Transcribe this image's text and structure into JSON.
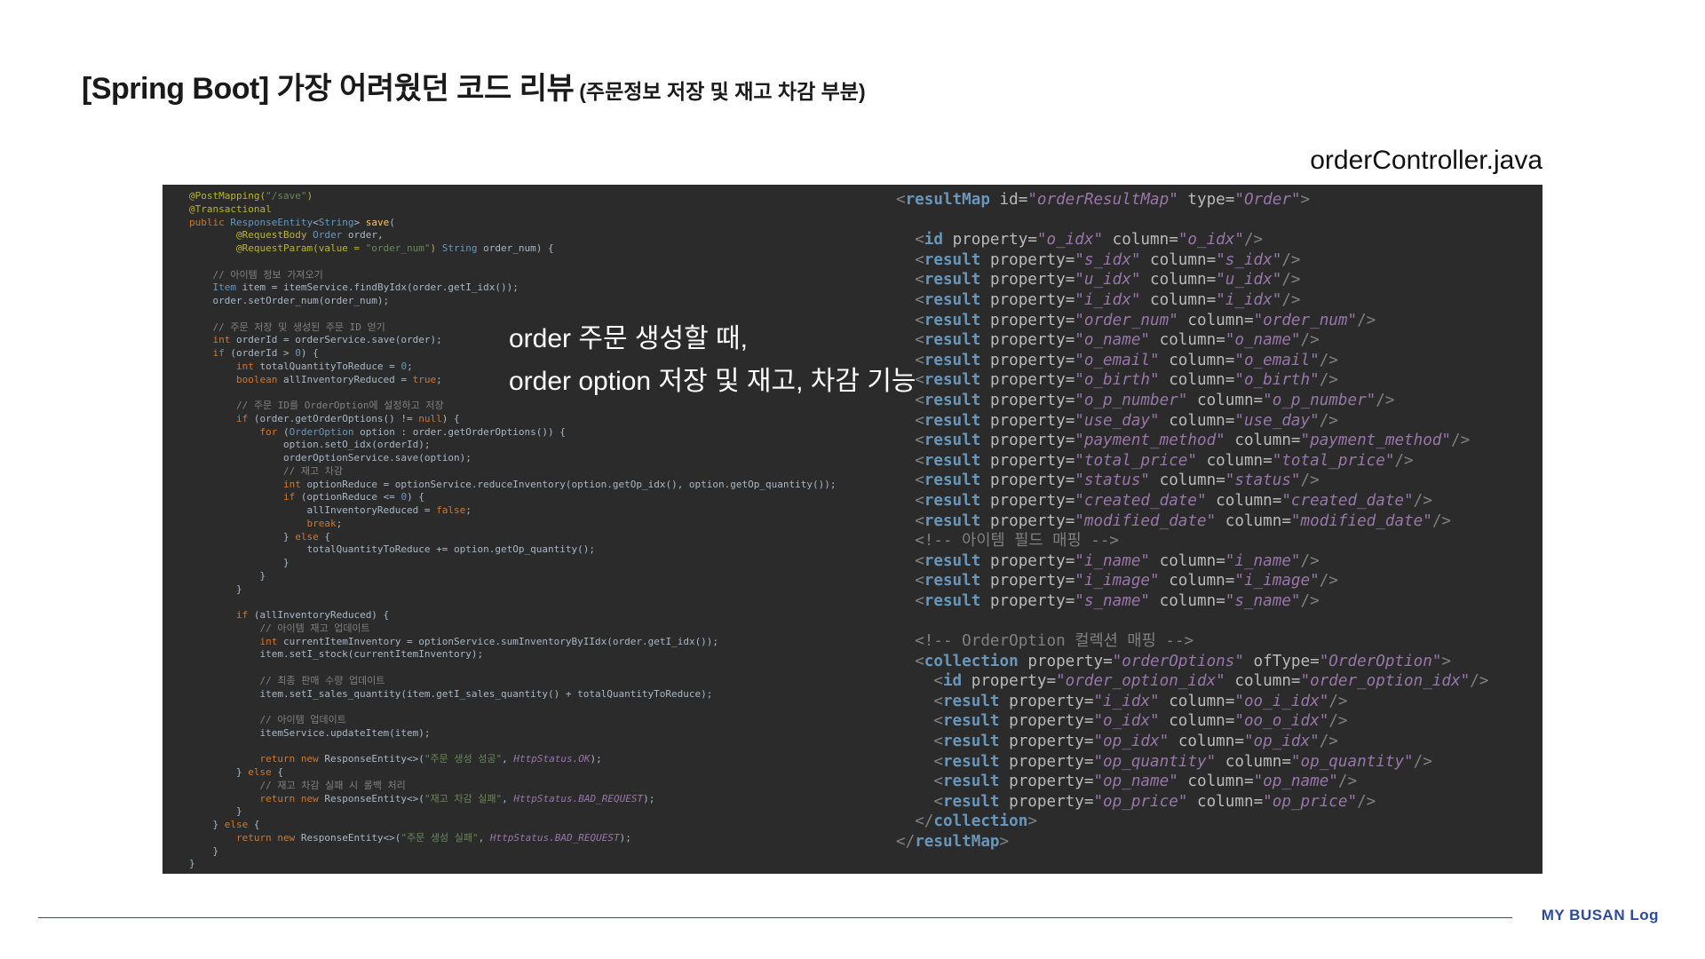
{
  "header": {
    "title_main": "[Spring Boot] 가장 어려웠던 코드 리뷰",
    "title_sub": "(주문정보 저장 및 재고 차감 부분)",
    "file_name": "orderController.java"
  },
  "callout": {
    "line1": "order 주문 생성할 때,",
    "line2": "order option 저장 및 재고, 차감 기능"
  },
  "footer": {
    "brand": "MY BUSAN Log"
  },
  "colors": {
    "panel_bg": "#2b2b2b",
    "brand": "#2f4a9c"
  },
  "java_code": [
    [
      [
        "ann",
        "@PostMapping("
      ],
      [
        "str",
        "\"/save\""
      ],
      [
        "ann",
        ")"
      ]
    ],
    [
      [
        "ann",
        "@Transactional"
      ]
    ],
    [
      [
        "kw",
        "public "
      ],
      [
        "typ",
        "ResponseEntity"
      ],
      [
        "",
        "<"
      ],
      [
        "typ",
        "String"
      ],
      [
        "",
        "> "
      ],
      [
        "fn",
        "save"
      ],
      [
        "",
        "("
      ]
    ],
    [
      [
        "",
        "        "
      ],
      [
        "ann",
        "@RequestBody "
      ],
      [
        "typ",
        "Order "
      ],
      [
        "",
        "order,"
      ]
    ],
    [
      [
        "",
        "        "
      ],
      [
        "ann",
        "@RequestParam(value = "
      ],
      [
        "str",
        "\"order_num\""
      ],
      [
        "ann",
        ") "
      ],
      [
        "typ",
        "String "
      ],
      [
        "",
        "order_num) {"
      ]
    ],
    [
      [
        "",
        ""
      ]
    ],
    [
      [
        "",
        "    "
      ],
      [
        "cmt",
        "// 아이템 정보 가져오기"
      ]
    ],
    [
      [
        "",
        "    "
      ],
      [
        "typ",
        "Item "
      ],
      [
        "",
        "item = itemService.findByIdx(order.getI_idx());"
      ]
    ],
    [
      [
        "",
        "    order.setOrder_num(order_num);"
      ]
    ],
    [
      [
        "",
        ""
      ]
    ],
    [
      [
        "",
        "    "
      ],
      [
        "cmt",
        "// 주문 저장 및 생성된 주문 ID 얻기"
      ]
    ],
    [
      [
        "",
        "    "
      ],
      [
        "kw",
        "int "
      ],
      [
        "",
        "orderId = orderService.save(order);"
      ]
    ],
    [
      [
        "",
        "    "
      ],
      [
        "kw",
        "if "
      ],
      [
        "",
        "(orderId > "
      ],
      [
        "typ",
        "0"
      ],
      [
        "",
        ") {"
      ]
    ],
    [
      [
        "",
        "        "
      ],
      [
        "kw",
        "int "
      ],
      [
        "",
        "totalQuantityToReduce = "
      ],
      [
        "typ",
        "0"
      ],
      [
        "",
        ";"
      ]
    ],
    [
      [
        "",
        "        "
      ],
      [
        "kw",
        "boolean "
      ],
      [
        "",
        "allInventoryReduced = "
      ],
      [
        "kw",
        "true"
      ],
      [
        "",
        ";"
      ]
    ],
    [
      [
        "",
        ""
      ]
    ],
    [
      [
        "",
        "        "
      ],
      [
        "cmt",
        "// 주문 ID를 OrderOption에 설정하고 저장"
      ]
    ],
    [
      [
        "",
        "        "
      ],
      [
        "kw",
        "if "
      ],
      [
        "",
        "(order.getOrderOptions() != "
      ],
      [
        "kw",
        "null"
      ],
      [
        "",
        ") {"
      ]
    ],
    [
      [
        "",
        "            "
      ],
      [
        "kw",
        "for "
      ],
      [
        "",
        "("
      ],
      [
        "typ",
        "OrderOption "
      ],
      [
        "",
        "option : order.getOrderOptions()) {"
      ]
    ],
    [
      [
        "",
        "                option.setO_idx(orderId);"
      ]
    ],
    [
      [
        "",
        "                orderOptionService.save(option);"
      ]
    ],
    [
      [
        "",
        "                "
      ],
      [
        "cmt",
        "// 재고 차감"
      ]
    ],
    [
      [
        "",
        "                "
      ],
      [
        "kw",
        "int "
      ],
      [
        "",
        "optionReduce = optionService.reduceInventory(option.getOp_idx(), option.getOp_quantity());"
      ]
    ],
    [
      [
        "",
        "                "
      ],
      [
        "kw",
        "if "
      ],
      [
        "",
        "(optionReduce <= "
      ],
      [
        "typ",
        "0"
      ],
      [
        "",
        ") {"
      ]
    ],
    [
      [
        "",
        "                    allInventoryReduced = "
      ],
      [
        "kw",
        "false"
      ],
      [
        "",
        ";"
      ]
    ],
    [
      [
        "",
        "                    "
      ],
      [
        "kw",
        "break"
      ],
      [
        "",
        ";"
      ]
    ],
    [
      [
        "",
        "                } "
      ],
      [
        "kw",
        "else "
      ],
      [
        "",
        "{"
      ]
    ],
    [
      [
        "",
        "                    totalQuantityToReduce += option.getOp_quantity();"
      ]
    ],
    [
      [
        "",
        "                }"
      ]
    ],
    [
      [
        "",
        "            }"
      ]
    ],
    [
      [
        "",
        "        }"
      ]
    ],
    [
      [
        "",
        ""
      ]
    ],
    [
      [
        "",
        "        "
      ],
      [
        "kw",
        "if "
      ],
      [
        "",
        "(allInventoryReduced) {"
      ]
    ],
    [
      [
        "",
        "            "
      ],
      [
        "cmt",
        "// 아이템 재고 업데이트"
      ]
    ],
    [
      [
        "",
        "            "
      ],
      [
        "kw",
        "int "
      ],
      [
        "",
        "currentItemInventory = optionService.sumInventoryByIIdx(order.getI_idx());"
      ]
    ],
    [
      [
        "",
        "            item.setI_stock(currentItemInventory);"
      ]
    ],
    [
      [
        "",
        ""
      ]
    ],
    [
      [
        "",
        "            "
      ],
      [
        "cmt",
        "// 최종 판매 수량 업데이트"
      ]
    ],
    [
      [
        "",
        "            item.setI_sales_quantity(item.getI_sales_quantity() + totalQuantityToReduce);"
      ]
    ],
    [
      [
        "",
        ""
      ]
    ],
    [
      [
        "",
        "            "
      ],
      [
        "cmt",
        "// 아이템 업데이트"
      ]
    ],
    [
      [
        "",
        "            itemService.updateItem(item);"
      ]
    ],
    [
      [
        "",
        ""
      ]
    ],
    [
      [
        "",
        "            "
      ],
      [
        "kw",
        "return new "
      ],
      [
        "",
        "ResponseEntity<>("
      ],
      [
        "str",
        "\"주문 생성 성공\""
      ],
      [
        "",
        ", "
      ],
      [
        "cst",
        "HttpStatus.OK"
      ],
      [
        "",
        ");"
      ]
    ],
    [
      [
        "",
        "        } "
      ],
      [
        "kw",
        "else "
      ],
      [
        "",
        "{"
      ]
    ],
    [
      [
        "",
        "            "
      ],
      [
        "cmt",
        "// 재고 차감 실패 시 롤백 처리"
      ]
    ],
    [
      [
        "",
        "            "
      ],
      [
        "kw",
        "return new "
      ],
      [
        "",
        "ResponseEntity<>("
      ],
      [
        "str",
        "\"재고 차감 실패\""
      ],
      [
        "",
        ", "
      ],
      [
        "cst",
        "HttpStatus.BAD_REQUEST"
      ],
      [
        "",
        ");"
      ]
    ],
    [
      [
        "",
        "        }"
      ]
    ],
    [
      [
        "",
        "    } "
      ],
      [
        "kw",
        "else "
      ],
      [
        "",
        "{"
      ]
    ],
    [
      [
        "",
        "        "
      ],
      [
        "kw",
        "return new "
      ],
      [
        "",
        "ResponseEntity<>("
      ],
      [
        "str",
        "\"주문 생성 실패\""
      ],
      [
        "",
        ", "
      ],
      [
        "cst",
        "HttpStatus.BAD_REQUEST"
      ],
      [
        "",
        ");"
      ]
    ],
    [
      [
        "",
        "    }"
      ]
    ],
    [
      [
        "",
        "}"
      ]
    ]
  ],
  "xml_code": [
    {
      "indent": 0,
      "tag": "resultMap",
      "attrs": [
        [
          "id",
          "orderResultMap"
        ],
        [
          "type",
          "Order"
        ]
      ],
      "close": ">"
    },
    {
      "blank": true
    },
    {
      "indent": 1,
      "tag": "id",
      "attrs": [
        [
          "property",
          "o_idx"
        ],
        [
          "column",
          "o_idx"
        ]
      ],
      "close": "/>"
    },
    {
      "indent": 1,
      "tag": "result",
      "attrs": [
        [
          "property",
          "s_idx"
        ],
        [
          "column",
          "s_idx"
        ]
      ],
      "close": "/>"
    },
    {
      "indent": 1,
      "tag": "result",
      "attrs": [
        [
          "property",
          "u_idx"
        ],
        [
          "column",
          "u_idx"
        ]
      ],
      "close": "/>"
    },
    {
      "indent": 1,
      "tag": "result",
      "attrs": [
        [
          "property",
          "i_idx"
        ],
        [
          "column",
          "i_idx"
        ]
      ],
      "close": "/>"
    },
    {
      "indent": 1,
      "tag": "result",
      "attrs": [
        [
          "property",
          "order_num"
        ],
        [
          "column",
          "order_num"
        ]
      ],
      "close": "/>"
    },
    {
      "indent": 1,
      "tag": "result",
      "attrs": [
        [
          "property",
          "o_name"
        ],
        [
          "column",
          "o_name"
        ]
      ],
      "close": "/>"
    },
    {
      "indent": 1,
      "tag": "result",
      "attrs": [
        [
          "property",
          "o_email"
        ],
        [
          "column",
          "o_email"
        ]
      ],
      "close": "/>"
    },
    {
      "indent": 1,
      "tag": "result",
      "attrs": [
        [
          "property",
          "o_birth"
        ],
        [
          "column",
          "o_birth"
        ]
      ],
      "close": "/>"
    },
    {
      "indent": 1,
      "tag": "result",
      "attrs": [
        [
          "property",
          "o_p_number"
        ],
        [
          "column",
          "o_p_number"
        ]
      ],
      "close": "/>"
    },
    {
      "indent": 1,
      "tag": "result",
      "attrs": [
        [
          "property",
          "use_day"
        ],
        [
          "column",
          "use_day"
        ]
      ],
      "close": "/>"
    },
    {
      "indent": 1,
      "tag": "result",
      "attrs": [
        [
          "property",
          "payment_method"
        ],
        [
          "column",
          "payment_method"
        ]
      ],
      "close": "/>"
    },
    {
      "indent": 1,
      "tag": "result",
      "attrs": [
        [
          "property",
          "total_price"
        ],
        [
          "column",
          "total_price"
        ]
      ],
      "close": "/>"
    },
    {
      "indent": 1,
      "tag": "result",
      "attrs": [
        [
          "property",
          "status"
        ],
        [
          "column",
          "status"
        ]
      ],
      "close": "/>"
    },
    {
      "indent": 1,
      "tag": "result",
      "attrs": [
        [
          "property",
          "created_date"
        ],
        [
          "column",
          "created_date"
        ]
      ],
      "close": "/>"
    },
    {
      "indent": 1,
      "tag": "result",
      "attrs": [
        [
          "property",
          "modified_date"
        ],
        [
          "column",
          "modified_date"
        ]
      ],
      "close": "/>"
    },
    {
      "indent": 1,
      "comment": "<!-- 아이템 필드 매핑 -->"
    },
    {
      "indent": 1,
      "tag": "result",
      "attrs": [
        [
          "property",
          "i_name"
        ],
        [
          "column",
          "i_name"
        ]
      ],
      "close": "/>"
    },
    {
      "indent": 1,
      "tag": "result",
      "attrs": [
        [
          "property",
          "i_image"
        ],
        [
          "column",
          "i_image"
        ]
      ],
      "close": "/>"
    },
    {
      "indent": 1,
      "tag": "result",
      "attrs": [
        [
          "property",
          "s_name"
        ],
        [
          "column",
          "s_name"
        ]
      ],
      "close": "/>"
    },
    {
      "blank": true
    },
    {
      "indent": 1,
      "comment": "<!-- OrderOption 컬렉션 매핑 -->"
    },
    {
      "indent": 1,
      "tag": "collection",
      "attrs": [
        [
          "property",
          "orderOptions"
        ],
        [
          "ofType",
          "OrderOption"
        ]
      ],
      "close": ">"
    },
    {
      "indent": 2,
      "tag": "id",
      "attrs": [
        [
          "property",
          "order_option_idx"
        ],
        [
          "column",
          "order_option_idx"
        ]
      ],
      "close": "/>"
    },
    {
      "indent": 2,
      "tag": "result",
      "attrs": [
        [
          "property",
          "i_idx"
        ],
        [
          "column",
          "oo_i_idx"
        ]
      ],
      "close": "/>"
    },
    {
      "indent": 2,
      "tag": "result",
      "attrs": [
        [
          "property",
          "o_idx"
        ],
        [
          "column",
          "oo_o_idx"
        ]
      ],
      "close": "/>"
    },
    {
      "indent": 2,
      "tag": "result",
      "attrs": [
        [
          "property",
          "op_idx"
        ],
        [
          "column",
          "op_idx"
        ]
      ],
      "close": "/>"
    },
    {
      "indent": 2,
      "tag": "result",
      "attrs": [
        [
          "property",
          "op_quantity"
        ],
        [
          "column",
          "op_quantity"
        ]
      ],
      "close": "/>"
    },
    {
      "indent": 2,
      "tag": "result",
      "attrs": [
        [
          "property",
          "op_name"
        ],
        [
          "column",
          "op_name"
        ]
      ],
      "close": "/>"
    },
    {
      "indent": 2,
      "tag": "result",
      "attrs": [
        [
          "property",
          "op_price"
        ],
        [
          "column",
          "op_price"
        ]
      ],
      "close": "/>"
    },
    {
      "indent": 1,
      "endtag": "collection"
    },
    {
      "indent": 0,
      "endtag": "resultMap"
    }
  ]
}
